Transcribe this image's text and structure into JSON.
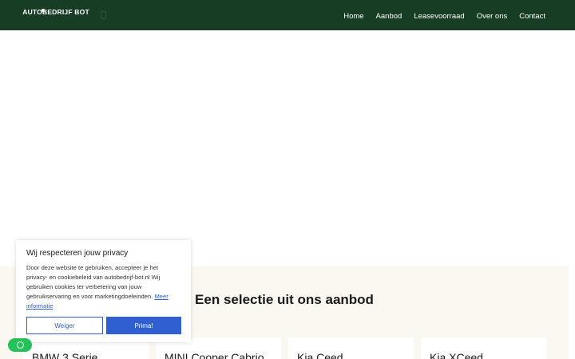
{
  "header": {
    "logo_text": "AUTOBEDRIJF BOT",
    "nav": [
      "Home",
      "Aanbod",
      "Leasevoorraad",
      "Over ons",
      "Contact"
    ]
  },
  "section": {
    "title": "Een selectie uit ons aanbod"
  },
  "cars": [
    "BMW 3 Serie",
    "MINI Cooper Cabrio",
    "Kia Ceed",
    "Kia XCeed"
  ],
  "privacy": {
    "title": "Wij respecteren jouw privacy",
    "body": "Door deze website te gebruiken, accepteer je het privacy- en cookiebeleid van autobedrijf-bot.nl Wij gebruiken cookies ter verbetering van jouw gebruikservaring en voor marketingdoeleinden.",
    "link": "Meer informatie",
    "decline": "Weiger",
    "accept": "Prima!"
  },
  "icons": {
    "phone": "phone-icon",
    "whatsapp": "whatsapp-icon"
  },
  "colors": {
    "header_bg": "#173d25",
    "section_bg": "#fbf7f1",
    "accent_blue": "#2f5fd0",
    "whatsapp_green": "#25c25a"
  }
}
